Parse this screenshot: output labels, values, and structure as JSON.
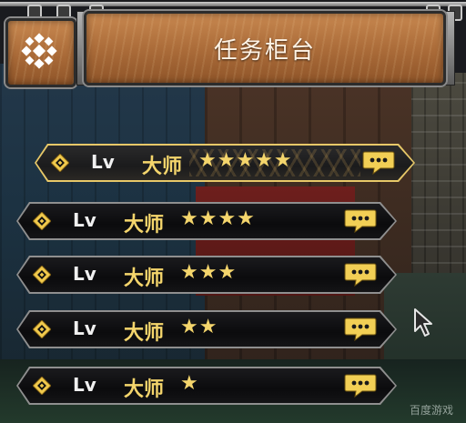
{
  "header": {
    "title": "任务柜台",
    "menu_icon": "snowflake-emblem-icon"
  },
  "quest_list": {
    "rows": [
      {
        "level_prefix": "Lv",
        "rank": "大师",
        "stars": "★★★★★",
        "star_count": 5,
        "selected": true
      },
      {
        "level_prefix": "Lv",
        "rank": "大师",
        "stars": "★★★★",
        "star_count": 4,
        "selected": false
      },
      {
        "level_prefix": "Lv",
        "rank": "大师",
        "stars": "★★★",
        "star_count": 3,
        "selected": false
      },
      {
        "level_prefix": "Lv",
        "rank": "大师",
        "stars": "★★",
        "star_count": 2,
        "selected": false
      },
      {
        "level_prefix": "Lv",
        "rank": "大师",
        "stars": "★",
        "star_count": 1,
        "selected": false
      }
    ],
    "row_icons": [
      "gold-diamond-icon",
      "chat-bubble-icon"
    ]
  },
  "watermark": "百度游戏",
  "colors": {
    "gold": "#f4d56c",
    "wood": "#a96a38",
    "row_bg": "#0d0d0f",
    "selected_outline": "#e7c868"
  }
}
